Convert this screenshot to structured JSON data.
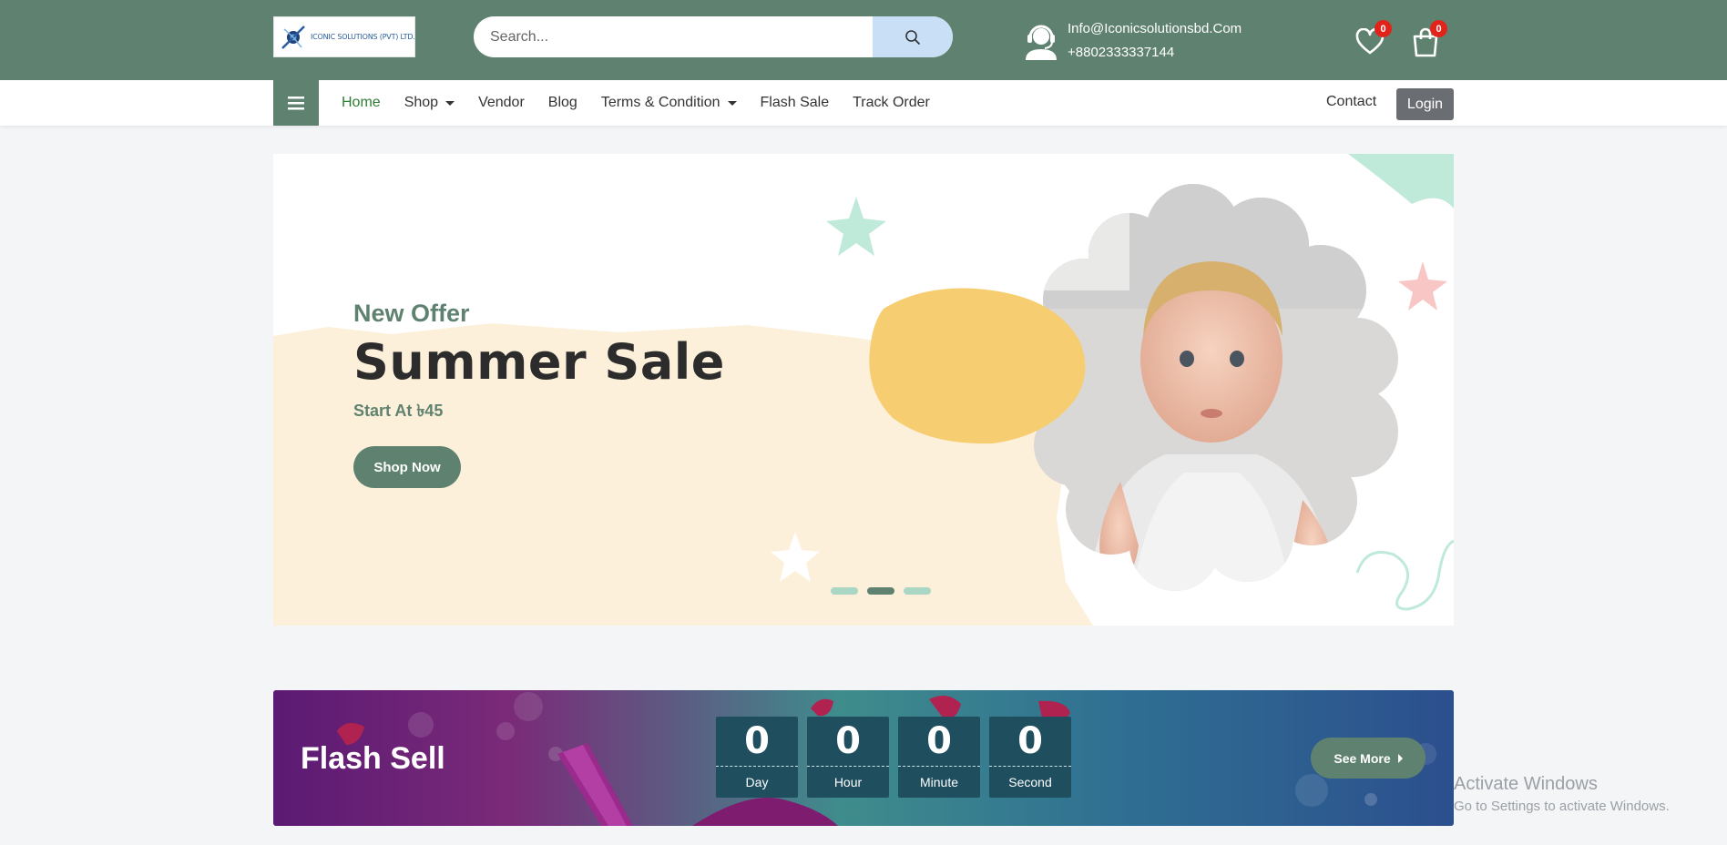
{
  "header": {
    "logo_text": "ICONIC SOLUTIONS (PVT) LTD.",
    "search_placeholder": "Search...",
    "email": "Info@Iconicsolutionsbd.Com",
    "phone": "+8802333337144",
    "wishlist_count": "0",
    "cart_count": "0"
  },
  "nav": {
    "items": [
      {
        "label": "Home",
        "active": true
      },
      {
        "label": "Shop",
        "dropdown": true
      },
      {
        "label": "Vendor"
      },
      {
        "label": "Blog"
      },
      {
        "label": "Terms & Condition",
        "dropdown": true
      },
      {
        "label": "Flash Sale"
      },
      {
        "label": "Track Order"
      }
    ],
    "contact": "Contact",
    "login": "Login"
  },
  "hero": {
    "eyebrow": "New Offer",
    "title": "Summer Sale",
    "subtitle": "Start At ৳45",
    "cta": "Shop Now",
    "slides": 3,
    "active_slide": 2
  },
  "flash_sale": {
    "title": "Flash Sell",
    "countdown": [
      {
        "value": "0",
        "label": "Day"
      },
      {
        "value": "0",
        "label": "Hour"
      },
      {
        "value": "0",
        "label": "Minute"
      },
      {
        "value": "0",
        "label": "Second"
      }
    ],
    "see_more": "See More"
  },
  "windows_watermark": {
    "line1": "Activate Windows",
    "line2": "Go to Settings to activate Windows."
  },
  "colors": {
    "brand_green": "#5f8270",
    "active_nav": "#2e7d32",
    "badge_red": "#e2231a",
    "search_button": "#c8dff5",
    "hero_cream": "#fdf0da",
    "hero_yellow": "#f7cd72"
  }
}
